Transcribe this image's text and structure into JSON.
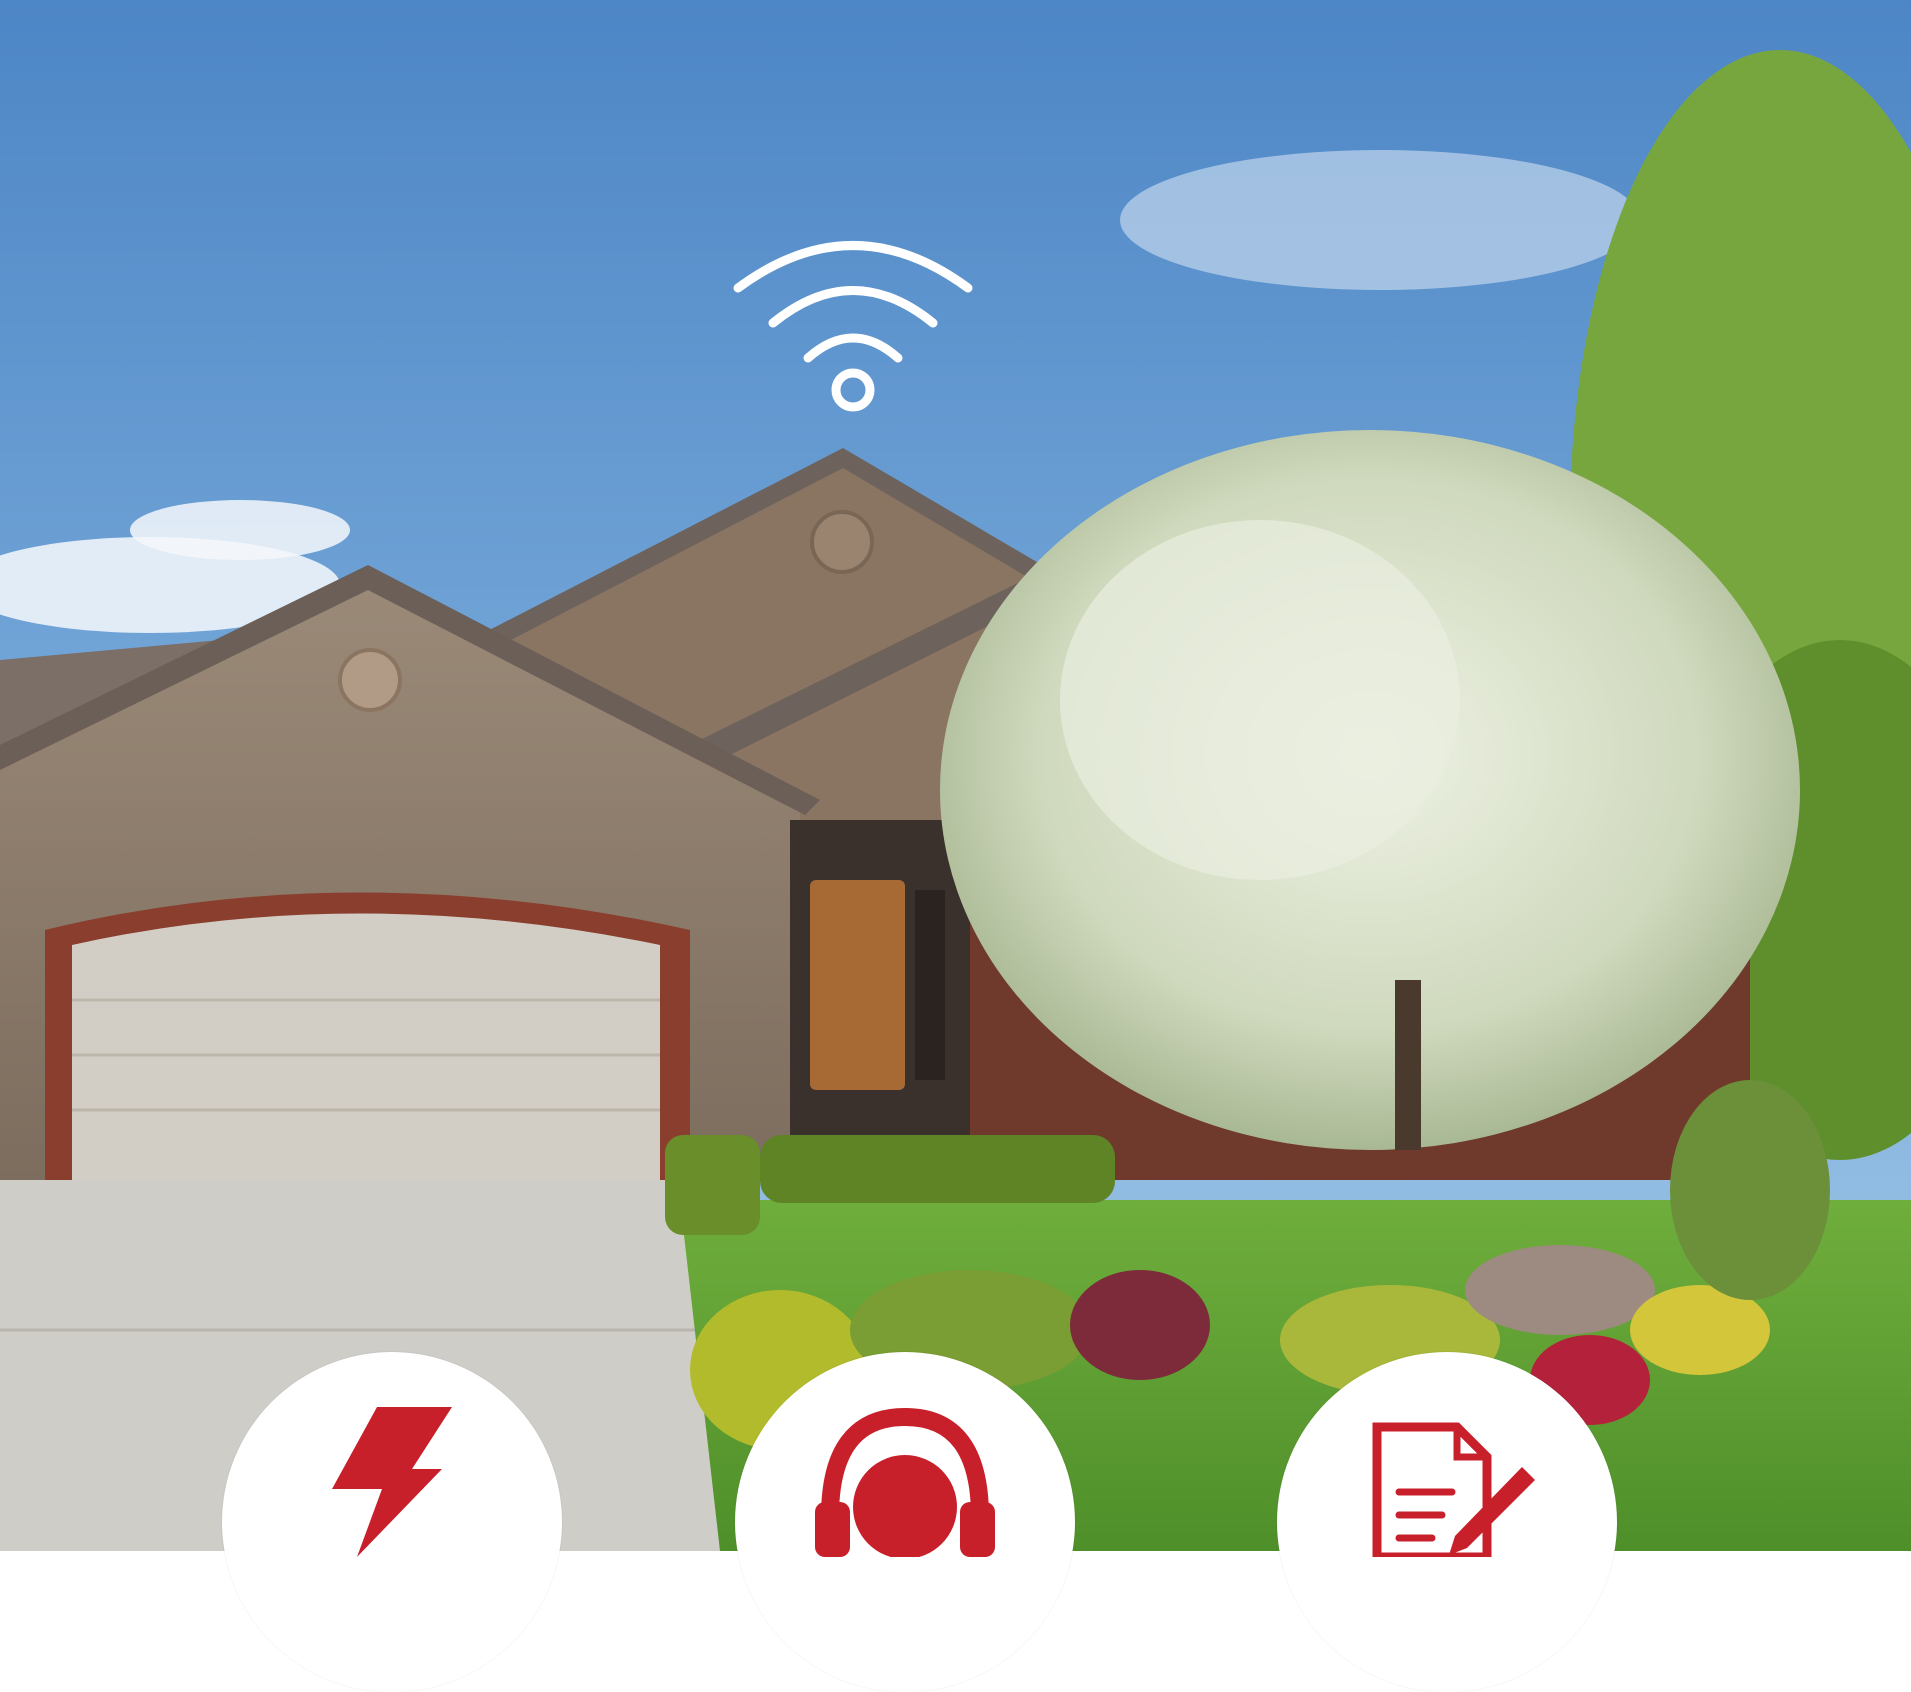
{
  "image": {
    "icons": {
      "wifi": "wifi-icon",
      "bolt": "lightning-bolt-icon",
      "support": "headset-support-icon",
      "contract": "document-pen-icon"
    },
    "colors": {
      "sky_top": "#4d86c6",
      "sky_bottom": "#a9cbe8",
      "icon_red": "#c8202b",
      "circle_bg": "#ffffff",
      "wifi_stroke": "#ffffff"
    }
  }
}
